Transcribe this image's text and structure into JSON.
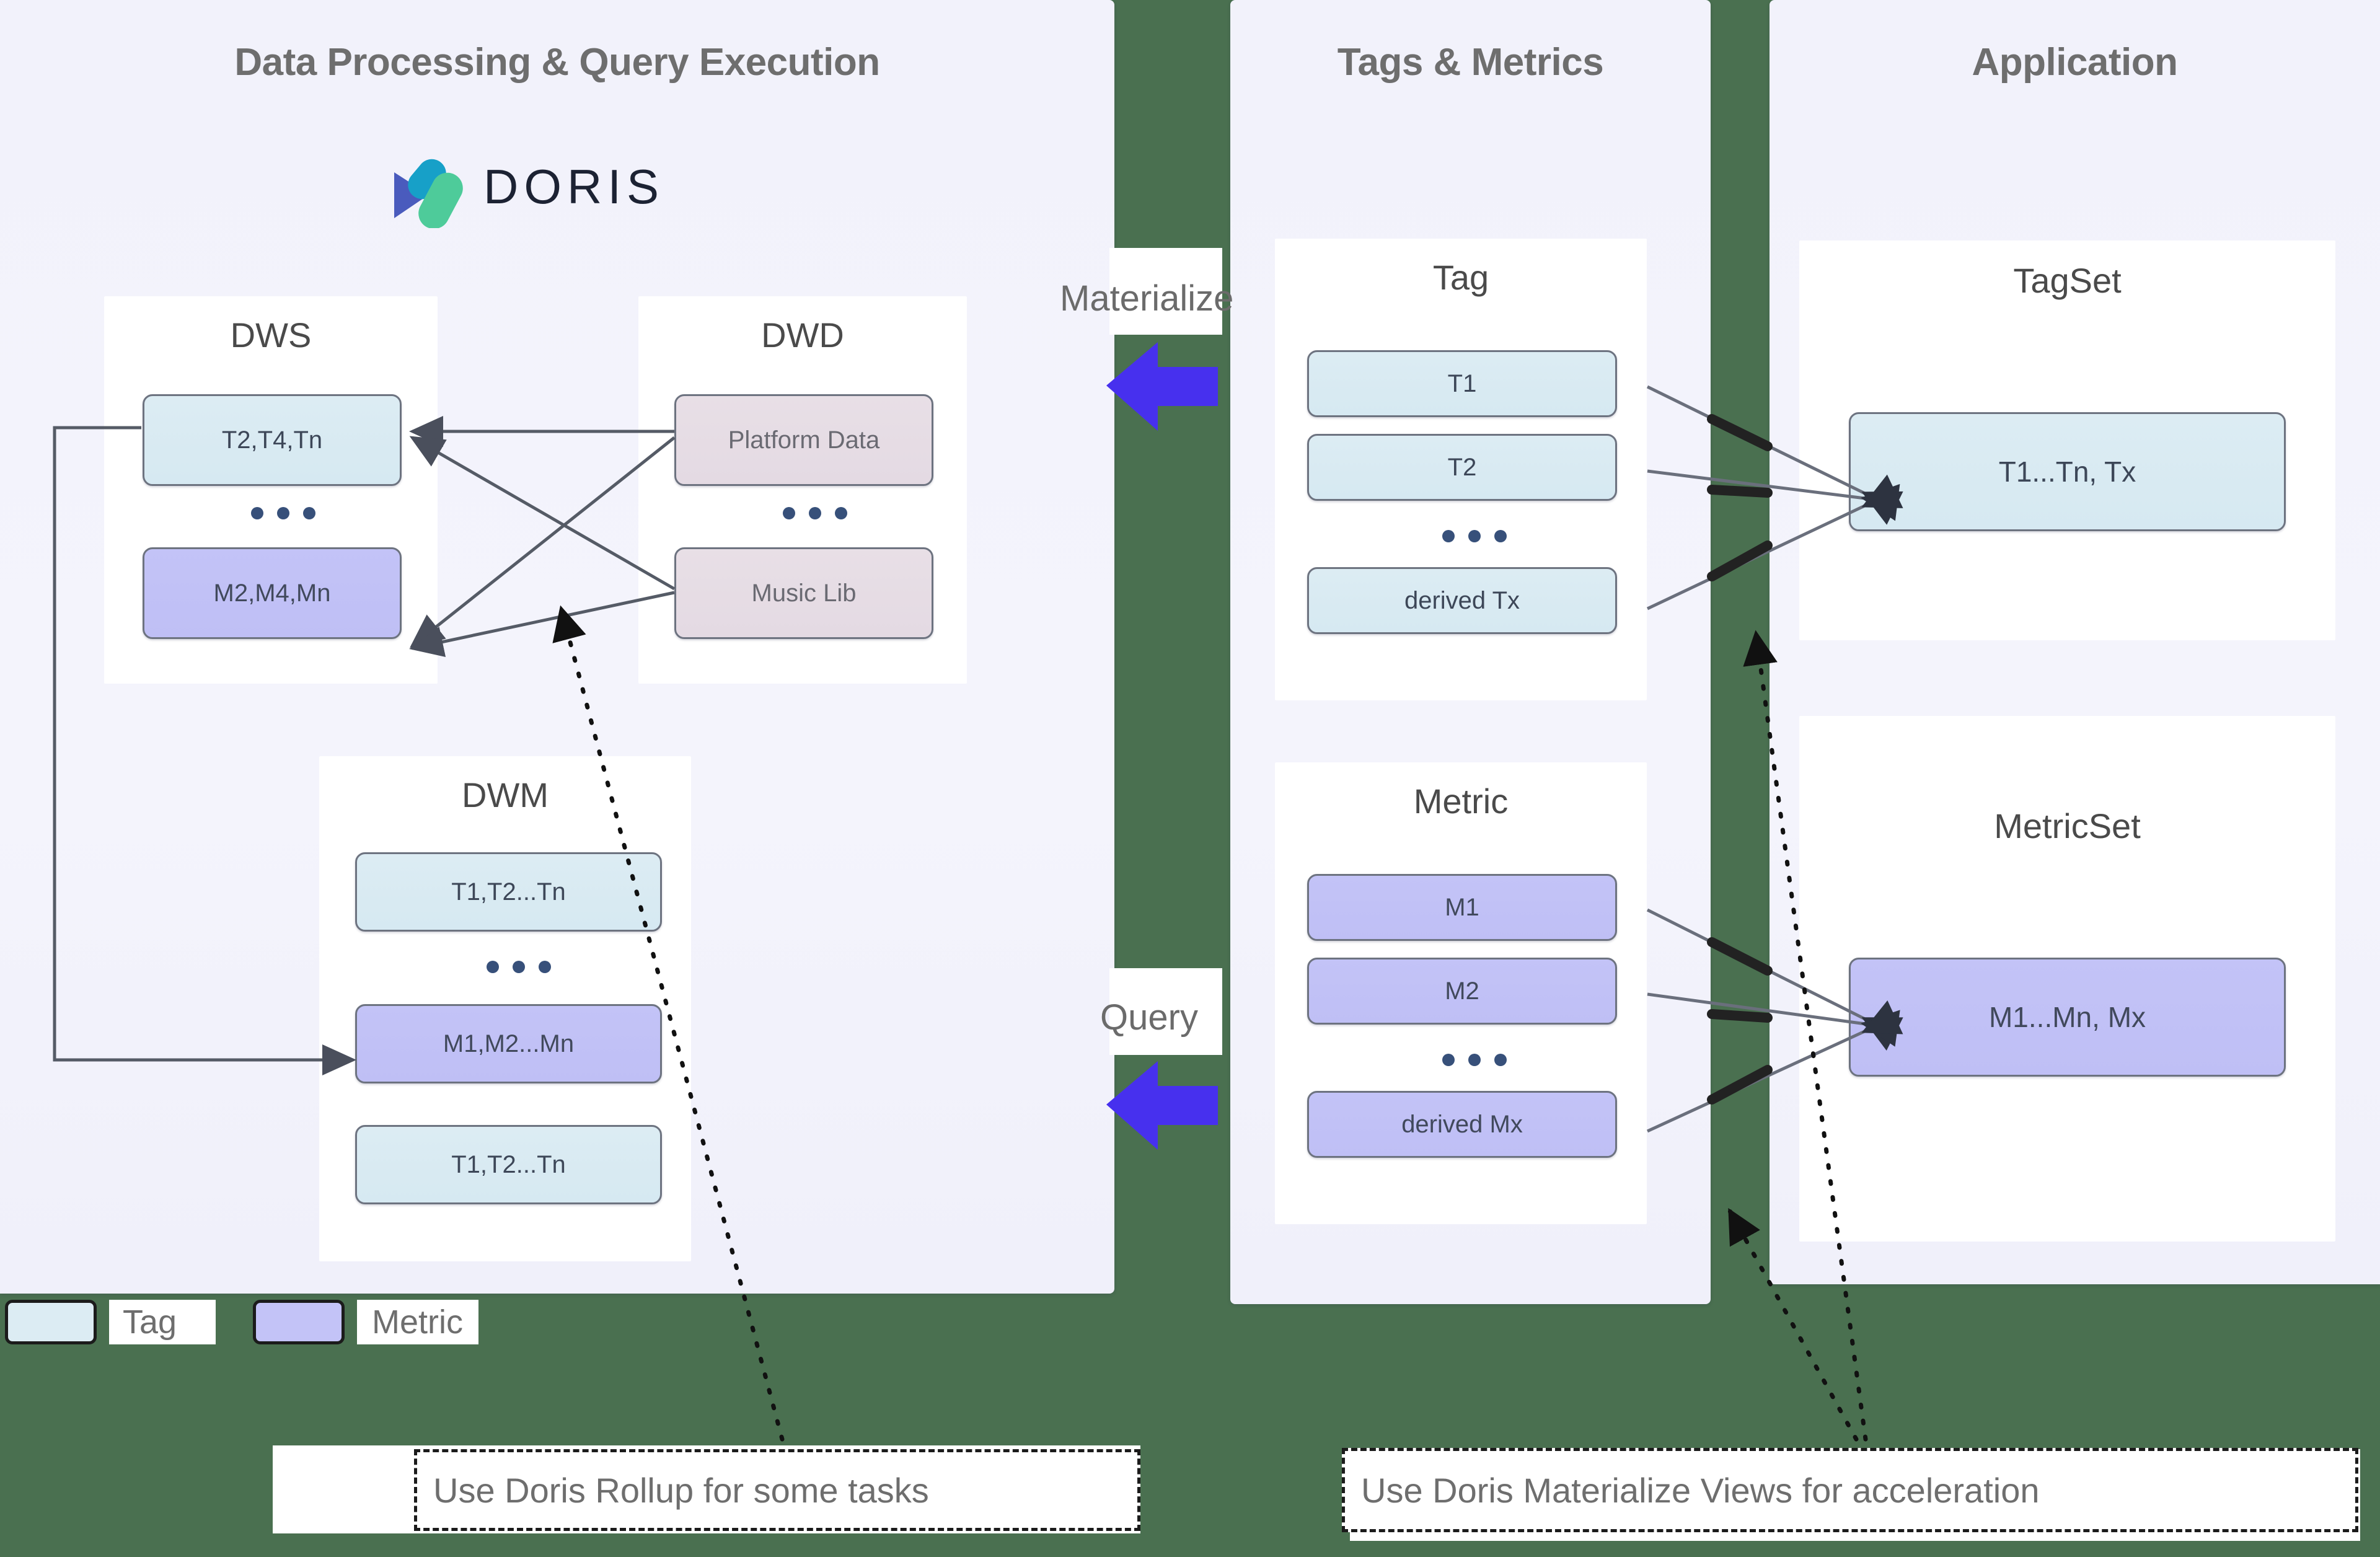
{
  "panels": [
    {
      "id": "data_processing",
      "title": "Data Processing & Query Execution"
    },
    {
      "id": "tags_metrics",
      "title": "Tags & Metrics"
    },
    {
      "id": "application",
      "title": "Application"
    }
  ],
  "brand": {
    "name": "DORIS",
    "logo_icon": "doris-logo-icon",
    "colors": {
      "cyan": "#17a0c8",
      "indigo": "#4a5bbd",
      "green": "#4ecb9a"
    }
  },
  "groups": {
    "dws": {
      "title": "DWS",
      "nodes": [
        {
          "label": "T2,T4,Tn",
          "kind": "tag"
        },
        {
          "label": "M2,M4,Mn",
          "kind": "metric"
        }
      ],
      "has_ellipsis": true
    },
    "dwd": {
      "title": "DWD",
      "nodes": [
        {
          "label": "Platform Data",
          "kind": "source"
        },
        {
          "label": "Music Lib",
          "kind": "source"
        }
      ],
      "has_ellipsis": true
    },
    "dwm": {
      "title": "DWM",
      "nodes": [
        {
          "label": "T1,T2...Tn",
          "kind": "tag"
        },
        {
          "label": "M1,M2...Mn",
          "kind": "metric"
        },
        {
          "label": "T1,T2...Tn",
          "kind": "tag"
        }
      ],
      "has_ellipsis": true
    },
    "tag": {
      "title": "Tag",
      "nodes": [
        {
          "label": "T1",
          "kind": "tag"
        },
        {
          "label": "T2",
          "kind": "tag"
        },
        {
          "label": "derived Tx",
          "kind": "tag"
        }
      ],
      "has_ellipsis": true
    },
    "metric": {
      "title": "Metric",
      "nodes": [
        {
          "label": "M1",
          "kind": "metric"
        },
        {
          "label": "M2",
          "kind": "metric"
        },
        {
          "label": "derived Mx",
          "kind": "metric"
        }
      ],
      "has_ellipsis": true
    },
    "tagset": {
      "title": "TagSet",
      "nodes": [
        {
          "label": "T1...Tn, Tx",
          "kind": "tag"
        }
      ],
      "has_ellipsis": false
    },
    "metricset": {
      "title": "MetricSet",
      "nodes": [
        {
          "label": "M1...Mn, Mx",
          "kind": "metric"
        }
      ],
      "has_ellipsis": false
    }
  },
  "flow_labels": {
    "materialize": "Materialize",
    "query": "Query"
  },
  "legend": {
    "items": [
      {
        "label": "Tag",
        "color": "#dcecf3"
      },
      {
        "label": "Metric",
        "color": "#c3c3f7"
      }
    ]
  },
  "notes": [
    {
      "id": "rollup",
      "text": "Use Doris Rollup for some tasks"
    },
    {
      "id": "materialize",
      "text": "Use Doris Materialize Views for acceleration"
    }
  ],
  "colors": {
    "background_green": "#4a7050",
    "panel_background": "#f2f2fb",
    "arrow_blue": "#4730ee",
    "node_border": "#6d7380",
    "title_gray": "#6e6e6e"
  }
}
